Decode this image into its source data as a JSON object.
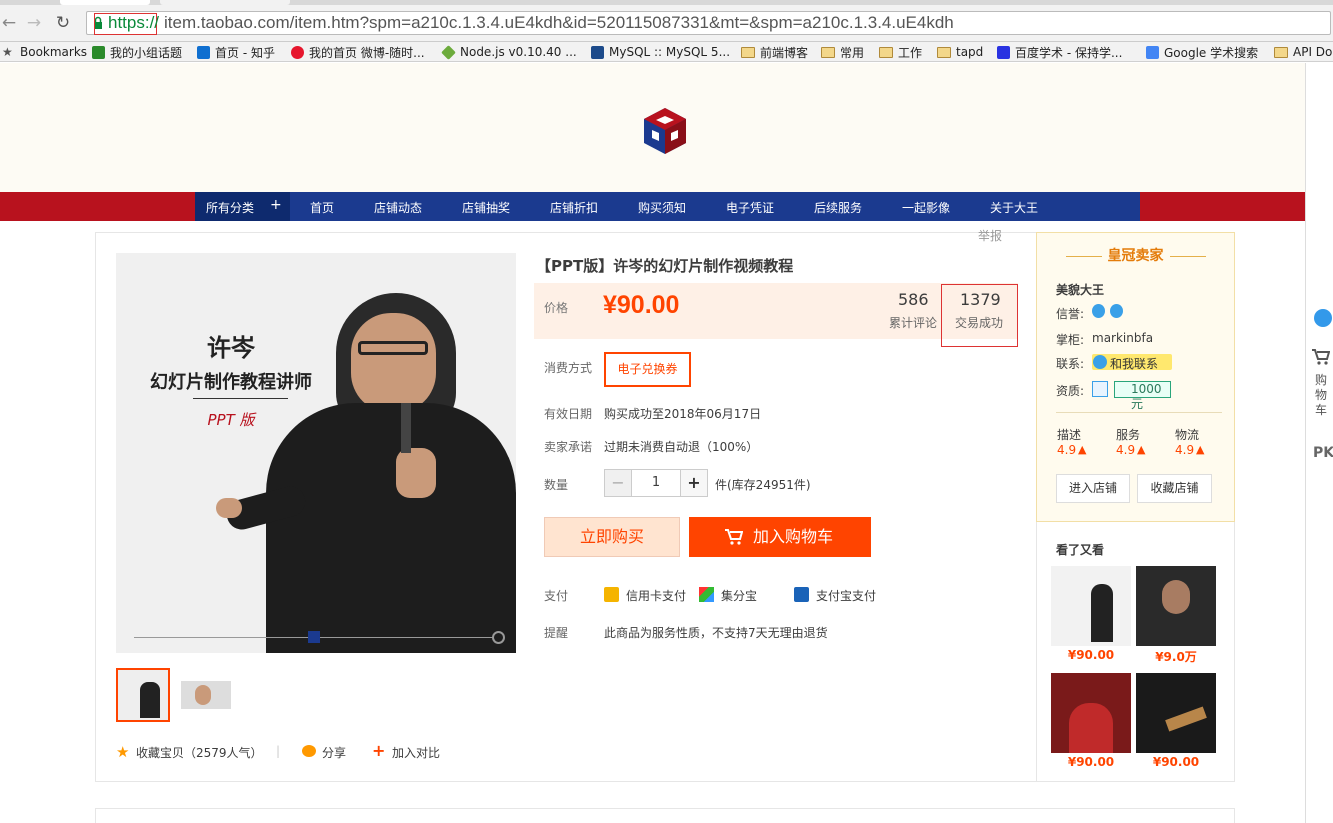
{
  "browser": {
    "url_scheme": "https://",
    "url_rest": "item.taobao.com/item.htm?spm=a210c.1.3.4.uE4kdh&id=520115087331&mt=&spm=a210c.1.3.4.uE4kdh"
  },
  "bookmarks": [
    {
      "label": "Bookmarks",
      "icon": "star-icon"
    },
    {
      "label": "我的小组话题",
      "icon": "douban-icon"
    },
    {
      "label": "首页 - 知乎",
      "icon": "zhihu-icon"
    },
    {
      "label": "我的首页 微博-随时...",
      "icon": "weibo-icon"
    },
    {
      "label": "Node.js v0.10.40 ...",
      "icon": "nodejs-icon"
    },
    {
      "label": "MySQL :: MySQL 5...",
      "icon": "mysql-icon"
    },
    {
      "label": "前端博客",
      "icon": "folder-icon"
    },
    {
      "label": "常用",
      "icon": "folder-icon"
    },
    {
      "label": "工作",
      "icon": "folder-icon"
    },
    {
      "label": "tapd",
      "icon": "folder-icon"
    },
    {
      "label": "百度学术 - 保持学...",
      "icon": "baidu-icon"
    },
    {
      "label": "Google 学术搜索",
      "icon": "google-scholar-icon"
    },
    {
      "label": "API Do",
      "icon": "folder-icon"
    }
  ],
  "shop_nav": {
    "all": "所有分类",
    "plus": "+",
    "items": [
      "首页",
      "店铺动态",
      "店铺抽奖",
      "店铺折扣",
      "购买须知",
      "电子凭证",
      "后续服务",
      "一起影像",
      "关于大王"
    ]
  },
  "photo": {
    "name": "许岑",
    "role": "幻灯片制作教程讲师",
    "tag": "PPT 版"
  },
  "report": "举报",
  "product": {
    "title": "【PPT版】许岑的幻灯片制作视频教程",
    "price_label": "价格",
    "price": "¥90.00",
    "reviews_count": "586",
    "reviews_label": "累计评论",
    "sales_count": "1379",
    "sales_label": "交易成功",
    "consume_label": "消费方式",
    "consume_value": "电子兑换券",
    "valid_label": "有效日期",
    "valid_value": "购买成功至2018年06月17日",
    "promise_label": "卖家承诺",
    "promise_value": "过期未消费自动退（100%）",
    "qty_label": "数量",
    "qty_minus": "−",
    "qty_value": "1",
    "qty_plus": "+",
    "qty_stock": "件(库存24951件)",
    "buy_now": "立即购买",
    "add_cart": "加入购物车",
    "pay_label": "支付",
    "pay_methods": [
      "信用卡支付",
      "集分宝",
      "支付宝支付"
    ],
    "notice_label": "提醒",
    "notice_value": "此商品为服务性质，不支持7天无理由退货"
  },
  "actions": {
    "favorite": "收藏宝贝（2579人气）",
    "share": "分享",
    "compare": "加入对比"
  },
  "seller": {
    "badge": "皇冠卖家",
    "name": "美貌大王",
    "credit_label": "信誉:",
    "keeper_label": "掌柜:",
    "keeper": "markinbfa",
    "contact_label": "联系:",
    "contact": "和我联系",
    "qual_label": "资质:",
    "deposit": "1000元",
    "ratings": [
      {
        "label": "描述",
        "value": "4.9"
      },
      {
        "label": "服务",
        "value": "4.9"
      },
      {
        "label": "物流",
        "value": "4.9"
      }
    ],
    "enter_shop": "进入店铺",
    "fav_shop": "收藏店铺"
  },
  "also_viewed": {
    "title": "看了又看",
    "items": [
      {
        "price": "¥90.00"
      },
      {
        "price": "¥9.0万"
      },
      {
        "price": "¥90.00"
      },
      {
        "price": "¥90.00"
      }
    ]
  },
  "right_bar": {
    "cart": "购物车",
    "pk": "PK"
  },
  "colors": {
    "taobao_orange": "#ff4400",
    "nav_red": "#b8121e",
    "nav_blue": "#1b3a8f"
  }
}
